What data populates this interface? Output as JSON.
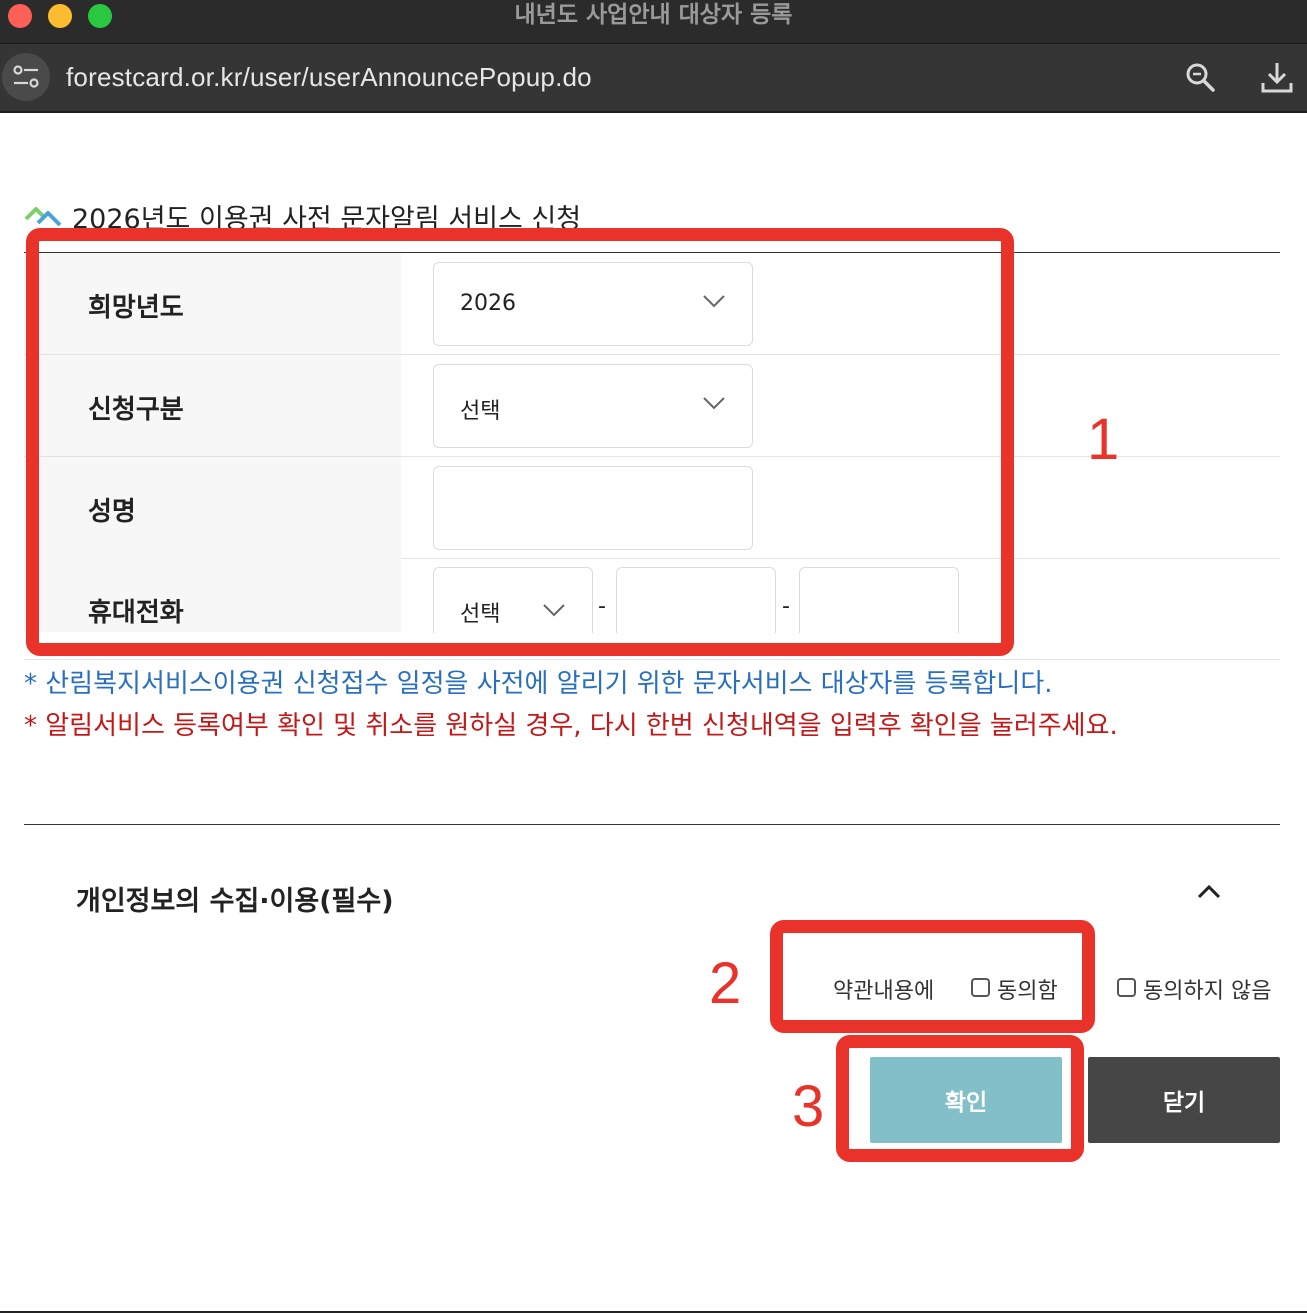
{
  "window": {
    "title": "내년도 사업안내 대상자 등록",
    "url": "forestcard.or.kr/user/userAnnouncePopup.do"
  },
  "page": {
    "title": "2026년도 이용권 사전 문자알림 서비스 신청"
  },
  "form": {
    "rows": [
      {
        "label": "희망년도",
        "selected": "2026"
      },
      {
        "label": "신청구분",
        "selected": "선택"
      },
      {
        "label": "성명",
        "value": ""
      },
      {
        "label": "휴대전화",
        "prefix_selected": "선택",
        "dash": "-",
        "mid": "",
        "last": ""
      }
    ]
  },
  "notices": {
    "blue": "* 산림복지서비스이용권 신청접수 일정을 사전에 알리기 위한 문자서비스 대상자를 등록합니다.",
    "red": "* 알림서비스 등록여부 확인 및 취소를 원하실 경우, 다시 한번 신청내역을 입력후 확인을 눌러주세요."
  },
  "privacy": {
    "title": "개인정보의 수집·이용(필수)",
    "agree_prefix": "약관내용에",
    "agree": "동의함",
    "disagree": "동의하지 않음"
  },
  "buttons": {
    "confirm": "확인",
    "close": "닫기"
  },
  "annotations": {
    "labels": [
      "1",
      "2",
      "3"
    ],
    "color": "#e8322a"
  },
  "colors": {
    "confirm_button": "#82bfc8",
    "close_button": "#464646",
    "notice_blue": "#2a6fbf",
    "notice_red": "#c21818"
  }
}
